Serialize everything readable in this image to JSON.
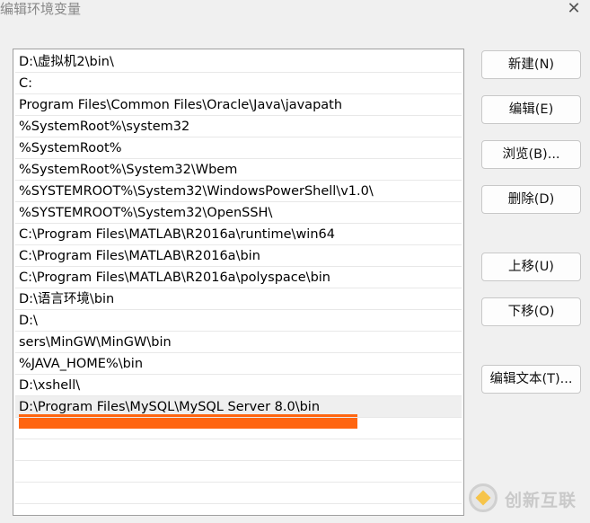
{
  "window": {
    "title": "编辑环境变量",
    "close_glyph": "✕"
  },
  "paths": [
    "D:\\虚拟机2\\bin\\",
    "C:",
    "Program Files\\Common Files\\Oracle\\Java\\javapath",
    "%SystemRoot%\\system32",
    "%SystemRoot%",
    "%SystemRoot%\\System32\\Wbem",
    "%SYSTEMROOT%\\System32\\WindowsPowerShell\\v1.0\\",
    "%SYSTEMROOT%\\System32\\OpenSSH\\",
    "C:\\Program Files\\MATLAB\\R2016a\\runtime\\win64",
    "C:\\Program Files\\MATLAB\\R2016a\\bin",
    "C:\\Program Files\\MATLAB\\R2016a\\polyspace\\bin",
    "D:\\语言环境\\bin",
    "D:\\",
    "sers\\MinGW\\MinGW\\bin",
    "%JAVA_HOME%\\bin",
    "D:\\xshell\\",
    "D:\\Program Files\\MySQL\\MySQL Server 8.0\\bin",
    ""
  ],
  "selected_index": 16,
  "buttons": {
    "new": "新建(N)",
    "edit": "编辑(E)",
    "browse": "浏览(B)...",
    "delete": "删除(D)",
    "move_up": "上移(U)",
    "move_down": "下移(O)",
    "edit_text": "编辑文本(T)..."
  },
  "watermark": {
    "text": "创新互联",
    "icon": "logo-icon"
  },
  "colors": {
    "redaction": "#ff6510",
    "selection": "#efefef"
  }
}
